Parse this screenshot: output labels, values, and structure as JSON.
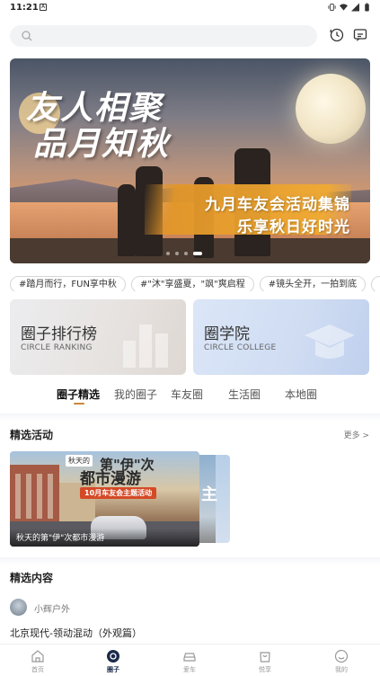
{
  "status_bar": {
    "time": "11:21"
  },
  "banner": {
    "headline_line1": "友人相聚",
    "headline_line2": "品月知秋",
    "subtitle_line1": "九月车友会活动集锦",
    "subtitle_line2": "乐享秋日好时光",
    "slide_count": 4,
    "active_slide": 4
  },
  "topic_tags": [
    "#踏月而行，FUN享中秋",
    "#\"沐\"享盛夏，\"飒\"爽启程",
    "#镜头全开，一拍到底",
    "#"
  ],
  "feature_cards": [
    {
      "title": "圈子排行榜",
      "subtitle": "CIRCLE RANKING"
    },
    {
      "title": "圈学院",
      "subtitle": "CIRCLE COLLEGE"
    }
  ],
  "tabs": [
    {
      "label": "圈子精选",
      "active": true
    },
    {
      "label": "我的圈子",
      "active": false
    },
    {
      "label": "车友圈",
      "active": false
    },
    {
      "label": "生活圈",
      "active": false
    },
    {
      "label": "本地圈",
      "active": false
    }
  ],
  "featured_activities": {
    "title": "精选活动",
    "more_label": "更多 >",
    "card": {
      "badge_top": "秋天的",
      "headline_a": "第\"伊\"次",
      "headline_b": "都市漫游",
      "tag": "10月车友会主题活动",
      "caption": "秋天的第\"伊\"次都市漫游",
      "next_card_glyph": "主"
    }
  },
  "featured_content": {
    "title": "精选内容",
    "author": "小辉户外",
    "post_title": "北京现代-领动混动（外观篇）"
  },
  "bottom_nav": [
    {
      "label": "首页",
      "icon": "home-icon",
      "active": false
    },
    {
      "label": "圈子",
      "icon": "circle-icon",
      "active": true
    },
    {
      "label": "爱车",
      "icon": "car-icon",
      "active": false
    },
    {
      "label": "悦享",
      "icon": "shopping-bag-icon",
      "active": false
    },
    {
      "label": "我的",
      "icon": "profile-icon",
      "active": false
    }
  ],
  "colors": {
    "tab_indicator": "#c8883a",
    "nav_active": "#1a2a4a",
    "search_bg": "#f2f3f5"
  }
}
